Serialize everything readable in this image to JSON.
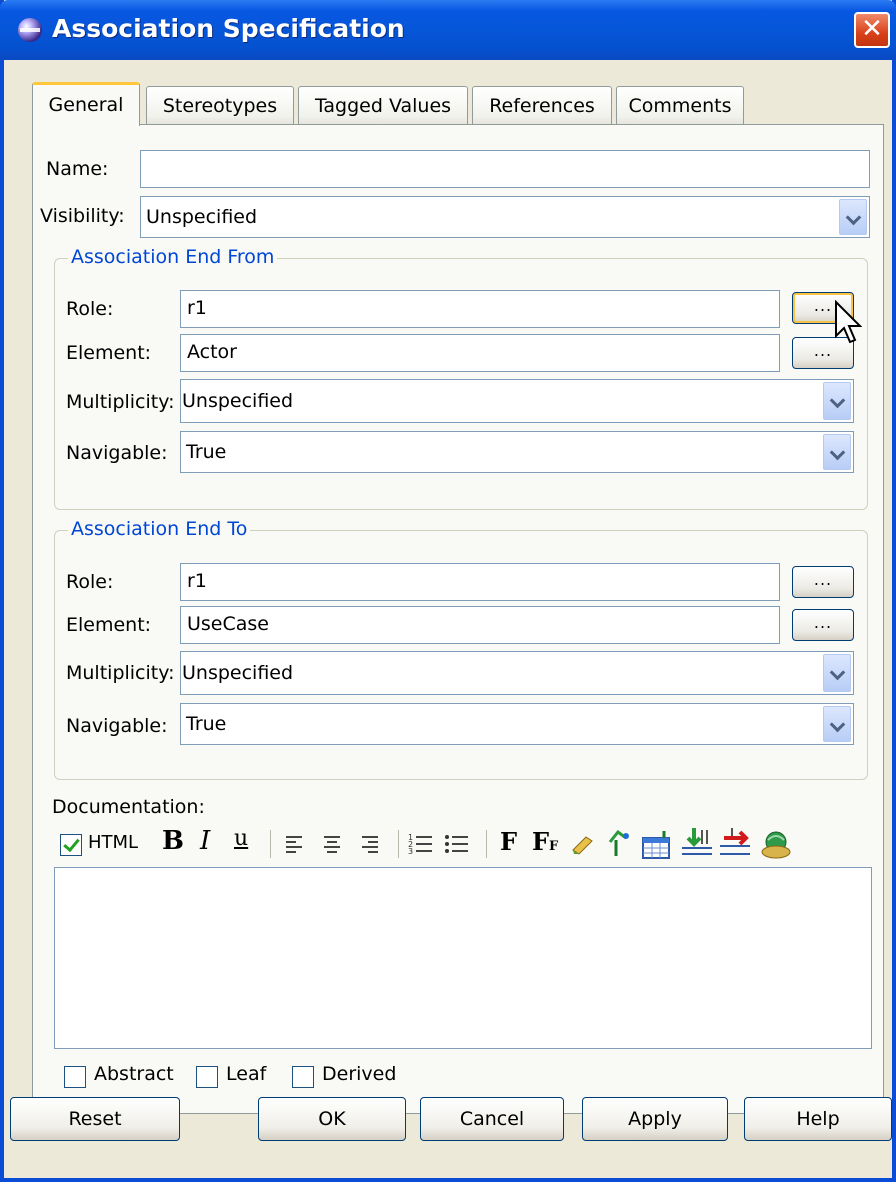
{
  "window": {
    "title": "Association Specification"
  },
  "tabs": [
    {
      "label": "General",
      "active": true
    },
    {
      "label": "Stereotypes",
      "active": false
    },
    {
      "label": "Tagged Values",
      "active": false
    },
    {
      "label": "References",
      "active": false
    },
    {
      "label": "Comments",
      "active": false
    }
  ],
  "general": {
    "name_label": "Name:",
    "name_value": "",
    "visibility_label": "Visibility:",
    "visibility_value": "Unspecified"
  },
  "end_from": {
    "title": "Association End From",
    "role_label": "Role:",
    "role_value": "r1",
    "element_label": "Element:",
    "element_value": "Actor",
    "multiplicity_label": "Multiplicity:",
    "multiplicity_value": "Unspecified",
    "navigable_label": "Navigable:",
    "navigable_value": "True",
    "browse_label": "..."
  },
  "end_to": {
    "title": "Association End To",
    "role_label": "Role:",
    "role_value": "r1",
    "element_label": "Element:",
    "element_value": "UseCase",
    "multiplicity_label": "Multiplicity:",
    "multiplicity_value": "Unspecified",
    "navigable_label": "Navigable:",
    "navigable_value": "True",
    "browse_label": "..."
  },
  "documentation": {
    "label": "Documentation:",
    "html_label": "HTML",
    "html_checked": true,
    "bold": "B",
    "italic": "I",
    "underline": "u",
    "font": "F",
    "font_size": "F",
    "font_size_sub": "F"
  },
  "flags": {
    "abstract": "Abstract",
    "leaf": "Leaf",
    "derived": "Derived"
  },
  "buttons": {
    "reset": "Reset",
    "ok": "OK",
    "cancel": "Cancel",
    "apply": "Apply",
    "help": "Help"
  }
}
